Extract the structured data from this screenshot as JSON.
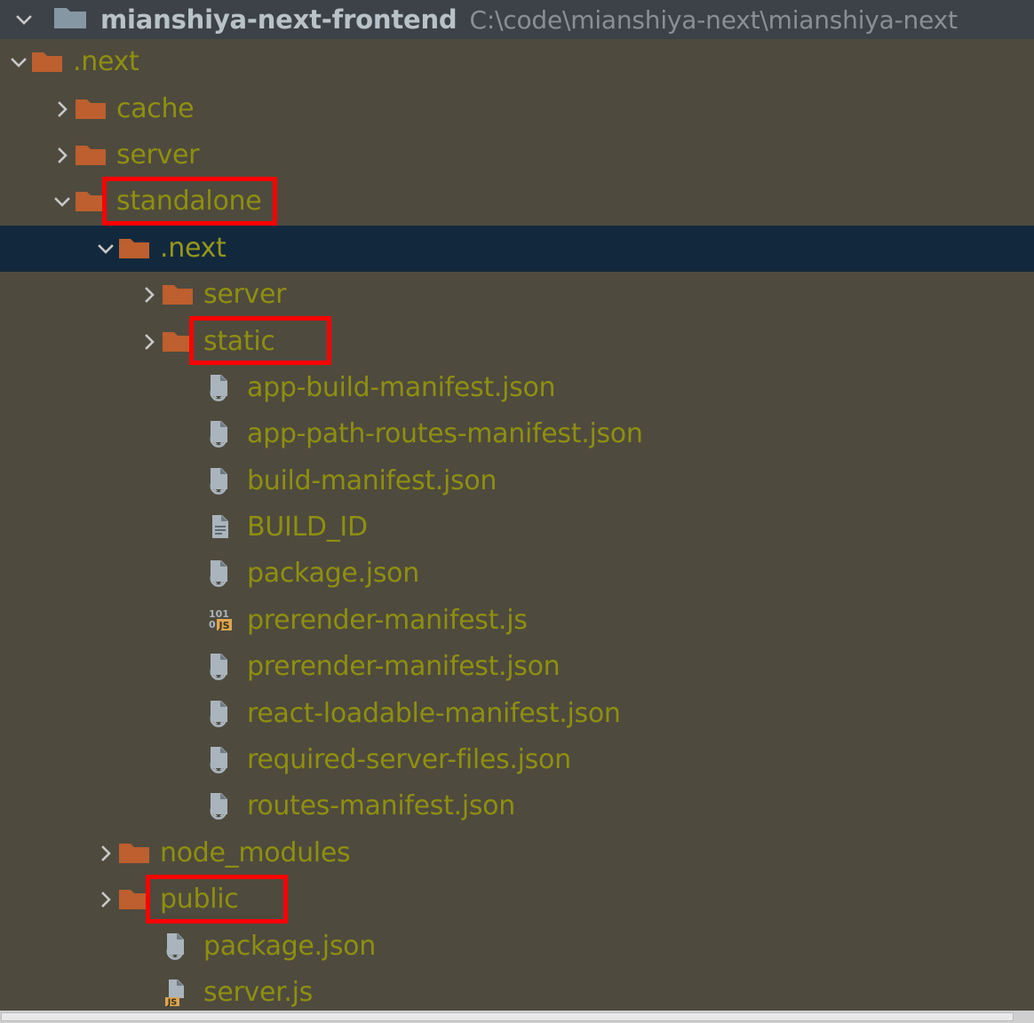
{
  "header": {
    "expander": "chevron-down",
    "icon": "folder-gray",
    "project_name": "mianshiya-next-frontend",
    "project_path": "C:\\code\\mianshiya-next\\mianshiya-next"
  },
  "colors": {
    "background": "#4e4a3e",
    "header_background": "#3c4247",
    "selected_row": "#12293d",
    "label_text": "#8f8f0f",
    "project_name_text": "#b9c2c9",
    "project_path_text": "#8a8f94",
    "folder_icon": "#bd5f2e",
    "root_folder_icon": "#8697a4",
    "file_icon": "#aab4bd",
    "js_badge": "#dda553",
    "highlight_outline": "#fe0000",
    "chevron": "#c8c8c8"
  },
  "tree": [
    {
      "label": ".next",
      "type": "folder",
      "expander": "chevron-down",
      "depth": 1,
      "selected": false,
      "highlighted": false
    },
    {
      "label": "cache",
      "type": "folder",
      "expander": "chevron-right",
      "depth": 2,
      "selected": false,
      "highlighted": false
    },
    {
      "label": "server",
      "type": "folder",
      "expander": "chevron-right",
      "depth": 2,
      "selected": false,
      "highlighted": false
    },
    {
      "label": "standalone",
      "type": "folder",
      "expander": "chevron-down",
      "depth": 2,
      "selected": false,
      "highlighted": true
    },
    {
      "label": ".next",
      "type": "folder",
      "expander": "chevron-down",
      "depth": 3,
      "selected": true,
      "highlighted": false
    },
    {
      "label": "server",
      "type": "folder",
      "expander": "chevron-right",
      "depth": 4,
      "selected": false,
      "highlighted": false
    },
    {
      "label": "static",
      "type": "folder",
      "expander": "chevron-right",
      "depth": 4,
      "selected": false,
      "highlighted": true
    },
    {
      "label": "app-build-manifest.json",
      "type": "json",
      "expander": "none",
      "depth": 5,
      "selected": false,
      "highlighted": false
    },
    {
      "label": "app-path-routes-manifest.json",
      "type": "json",
      "expander": "none",
      "depth": 5,
      "selected": false,
      "highlighted": false
    },
    {
      "label": "build-manifest.json",
      "type": "json",
      "expander": "none",
      "depth": 5,
      "selected": false,
      "highlighted": false
    },
    {
      "label": "BUILD_ID",
      "type": "text",
      "expander": "none",
      "depth": 5,
      "selected": false,
      "highlighted": false
    },
    {
      "label": "package.json",
      "type": "json",
      "expander": "none",
      "depth": 5,
      "selected": false,
      "highlighted": false
    },
    {
      "label": "prerender-manifest.js",
      "type": "jsmin",
      "expander": "none",
      "depth": 5,
      "selected": false,
      "highlighted": false
    },
    {
      "label": "prerender-manifest.json",
      "type": "json",
      "expander": "none",
      "depth": 5,
      "selected": false,
      "highlighted": false
    },
    {
      "label": "react-loadable-manifest.json",
      "type": "json",
      "expander": "none",
      "depth": 5,
      "selected": false,
      "highlighted": false
    },
    {
      "label": "required-server-files.json",
      "type": "json",
      "expander": "none",
      "depth": 5,
      "selected": false,
      "highlighted": false
    },
    {
      "label": "routes-manifest.json",
      "type": "json",
      "expander": "none",
      "depth": 5,
      "selected": false,
      "highlighted": false
    },
    {
      "label": "node_modules",
      "type": "folder",
      "expander": "chevron-right",
      "depth": 3,
      "selected": false,
      "highlighted": false
    },
    {
      "label": "public",
      "type": "folder",
      "expander": "chevron-right",
      "depth": 3,
      "selected": false,
      "highlighted": true
    },
    {
      "label": "package.json",
      "type": "json",
      "expander": "none",
      "depth": 4,
      "selected": false,
      "highlighted": false
    },
    {
      "label": "server.js",
      "type": "js",
      "expander": "none",
      "depth": 4,
      "selected": false,
      "highlighted": false
    }
  ],
  "scrollbar": {
    "orientation": "horizontal"
  }
}
